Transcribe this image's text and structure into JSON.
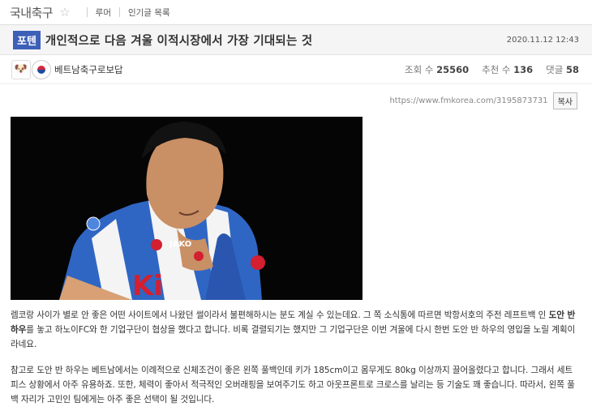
{
  "header": {
    "board_title": "국내축구",
    "nav": [
      "루머",
      "인기글 목록"
    ]
  },
  "post": {
    "tag": "포텐",
    "title": "개인적으로 다음 겨울 이적시장에서 가장 기대되는 것",
    "date": "2020.11.12 12:43",
    "author": "베트남축구로보답",
    "stats": {
      "views_label": "조회 수",
      "views": "25560",
      "likes_label": "추천 수",
      "likes": "136",
      "comments_label": "댓글",
      "comments": "58"
    },
    "url": "https://www.fmkorea.com/3195873731",
    "copy_label": "복사",
    "photo_text": {
      "sponsor": "JAKO",
      "shirt": "Ki"
    },
    "body": {
      "p1_a": "렘코랑 사이가 별로 안 좋은 어떤 사이트에서 나왔던 썰이라서 불편해하시는 분도 계실 수 있는데요. 그 쪽 소식통에 따르면 박항서호의 주전 레프트백 인 ",
      "p1_bold": "도안 반 하우",
      "p1_b": "를 놓고 하노이FC와 한 기업구단이 협상을 했다고 합니다. 비록 결렬되기는 했지만 그 기업구단은 이번 겨울에 다시 한번 도안 반 하우의 영입을 노릴 계획이라네요.",
      "p2": "참고로 도안 반 하우는 베트남에서는 이례적으로 신체조건이 좋은 왼쪽 풀백인데 키가 185cm이고 몸무게도 80kg 이상까지 끌어올렸다고 합니다. 그래서 세트피스 상황에서 아주 유용하죠. 또한, 체력이 좋아서 적극적인 오버래핑을 보여주기도 하고 아웃프론트로 크로스를 날리는 등 기술도 꽤 좋습니다. 따라서, 왼쪽 풀백 자리가 고민인 팀에게는 아주 좋은 선택이 될 것입니다."
    }
  }
}
